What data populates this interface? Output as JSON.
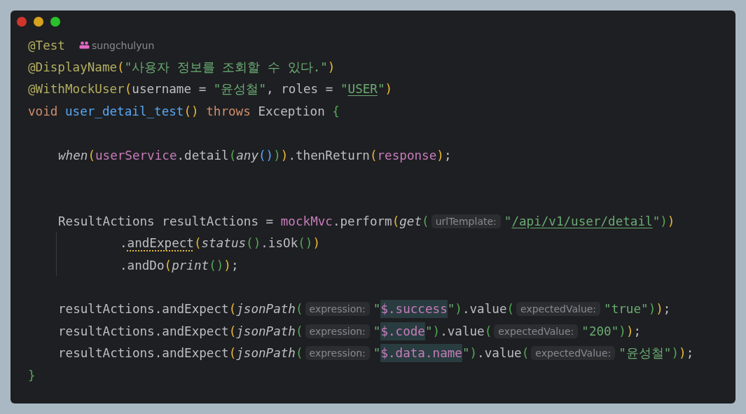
{
  "window": {
    "buttons": [
      {
        "kind": "close"
      },
      {
        "kind": "minimize"
      },
      {
        "kind": "zoom"
      }
    ]
  },
  "lines": [
    {
      "kind": "code",
      "segments": [
        {
          "kind": "code",
          "tokens": [
            {
              "text": "@Test",
              "kind": "annotation"
            }
          ]
        },
        {
          "kind": "author",
          "text": "sungchulyun"
        }
      ]
    },
    {
      "kind": "code",
      "segments": [
        {
          "kind": "code",
          "tokens": [
            {
              "text": "@DisplayName",
              "kind": "annotation"
            },
            {
              "text": "(",
              "kind": "paren1"
            },
            {
              "text": "\"사용자 정보를 조회할 수 있다.\"",
              "kind": "string"
            },
            {
              "text": ")",
              "kind": "paren1"
            }
          ]
        }
      ]
    },
    {
      "kind": "code",
      "segments": [
        {
          "kind": "code",
          "tokens": [
            {
              "text": "@WithMockUser",
              "kind": "annotation"
            },
            {
              "text": "(",
              "kind": "paren1"
            },
            {
              "text": "username = ",
              "kind": "plain"
            },
            {
              "text": "\"윤성철\"",
              "kind": "string"
            },
            {
              "text": ", roles = ",
              "kind": "plain"
            },
            {
              "text": "\"",
              "kind": "string"
            },
            {
              "text": "USER",
              "kind": "link"
            },
            {
              "text": "\"",
              "kind": "string"
            },
            {
              "text": ")",
              "kind": "paren1"
            }
          ]
        }
      ]
    },
    {
      "kind": "code",
      "segments": [
        {
          "kind": "code",
          "tokens": [
            {
              "text": "void ",
              "kind": "keyword"
            },
            {
              "text": "user_detail_test",
              "kind": "method"
            },
            {
              "text": "()",
              "kind": "paren1"
            },
            {
              "text": " throws ",
              "kind": "keyword"
            },
            {
              "text": "Exception ",
              "kind": "plain"
            },
            {
              "text": "{",
              "kind": "paren2"
            }
          ]
        }
      ],
      "children": [
        {
          "kind": "blank"
        },
        {
          "kind": "code",
          "segments": [
            {
              "kind": "code",
              "tokens": [
                {
                  "text": "when",
                  "kind": "call"
                },
                {
                  "text": "(",
                  "kind": "paren1"
                },
                {
                  "text": "userService",
                  "kind": "field"
                },
                {
                  "text": ".detail",
                  "kind": "plain"
                },
                {
                  "text": "(",
                  "kind": "paren2"
                },
                {
                  "text": "any",
                  "kind": "call"
                },
                {
                  "text": "()",
                  "kind": "paren3"
                },
                {
                  "text": ")",
                  "kind": "paren2"
                },
                {
                  "text": ")",
                  "kind": "paren1"
                },
                {
                  "text": ".thenReturn",
                  "kind": "plain"
                },
                {
                  "text": "(",
                  "kind": "paren1"
                },
                {
                  "text": "response",
                  "kind": "field"
                },
                {
                  "text": ")",
                  "kind": "paren1"
                },
                {
                  "text": ";",
                  "kind": "plain"
                }
              ]
            }
          ]
        },
        {
          "kind": "blank"
        },
        {
          "kind": "blank"
        },
        {
          "kind": "code",
          "segments": [
            {
              "kind": "code",
              "tokens": [
                {
                  "text": "ResultActions resultActions = ",
                  "kind": "plain"
                },
                {
                  "text": "mockMvc",
                  "kind": "field"
                },
                {
                  "text": ".perform",
                  "kind": "plain"
                },
                {
                  "text": "(",
                  "kind": "paren1"
                },
                {
                  "text": "get",
                  "kind": "call"
                },
                {
                  "text": "(",
                  "kind": "paren2"
                }
              ]
            },
            {
              "kind": "hint",
              "text": "urlTemplate:"
            },
            {
              "kind": "code",
              "tokens": [
                {
                  "text": "\"",
                  "kind": "string"
                },
                {
                  "text": "/api/v1/user/detail",
                  "kind": "link"
                },
                {
                  "text": "\"",
                  "kind": "string"
                },
                {
                  "text": ")",
                  "kind": "paren2"
                },
                {
                  "text": ")",
                  "kind": "paren1"
                }
              ]
            }
          ],
          "children": [
            {
              "kind": "code",
              "segments": [
                {
                  "kind": "code",
                  "tokens": [
                    {
                      "text": ".",
                      "kind": "plain"
                    },
                    {
                      "text": "andExpect",
                      "kind": "warned"
                    },
                    {
                      "text": "(",
                      "kind": "paren1"
                    },
                    {
                      "text": "status",
                      "kind": "call"
                    },
                    {
                      "text": "()",
                      "kind": "paren2"
                    },
                    {
                      "text": ".isOk",
                      "kind": "plain"
                    },
                    {
                      "text": "()",
                      "kind": "paren2"
                    },
                    {
                      "text": ")",
                      "kind": "paren1"
                    }
                  ]
                }
              ]
            },
            {
              "kind": "code",
              "segments": [
                {
                  "kind": "code",
                  "tokens": [
                    {
                      "text": ".andDo",
                      "kind": "plain"
                    },
                    {
                      "text": "(",
                      "kind": "paren1"
                    },
                    {
                      "text": "print",
                      "kind": "call"
                    },
                    {
                      "text": "()",
                      "kind": "paren2"
                    },
                    {
                      "text": ")",
                      "kind": "paren1"
                    },
                    {
                      "text": ";",
                      "kind": "plain"
                    }
                  ]
                }
              ]
            }
          ]
        },
        {
          "kind": "blank"
        },
        {
          "kind": "code",
          "segments": [
            {
              "kind": "code",
              "tokens": [
                {
                  "text": "resultActions.andExpect",
                  "kind": "plain"
                },
                {
                  "text": "(",
                  "kind": "paren1"
                },
                {
                  "text": "jsonPath",
                  "kind": "call"
                },
                {
                  "text": "(",
                  "kind": "paren2"
                }
              ]
            },
            {
              "kind": "hint",
              "text": "expression:"
            },
            {
              "kind": "code",
              "tokens": [
                {
                  "text": "\"",
                  "kind": "string"
                },
                {
                  "text": "$.success",
                  "kind": "match"
                },
                {
                  "text": "\"",
                  "kind": "string"
                },
                {
                  "text": ")",
                  "kind": "paren2"
                },
                {
                  "text": ".value",
                  "kind": "plain"
                },
                {
                  "text": "(",
                  "kind": "paren2"
                }
              ]
            },
            {
              "kind": "hint",
              "text": "expectedValue:"
            },
            {
              "kind": "code",
              "tokens": [
                {
                  "text": "\"true\"",
                  "kind": "string"
                },
                {
                  "text": ")",
                  "kind": "paren2"
                },
                {
                  "text": ")",
                  "kind": "paren1"
                },
                {
                  "text": ";",
                  "kind": "plain"
                }
              ]
            }
          ]
        },
        {
          "kind": "code",
          "segments": [
            {
              "kind": "code",
              "tokens": [
                {
                  "text": "resultActions.andExpect",
                  "kind": "plain"
                },
                {
                  "text": "(",
                  "kind": "paren1"
                },
                {
                  "text": "jsonPath",
                  "kind": "call"
                },
                {
                  "text": "(",
                  "kind": "paren2"
                }
              ]
            },
            {
              "kind": "hint",
              "text": "expression:"
            },
            {
              "kind": "code",
              "tokens": [
                {
                  "text": "\"",
                  "kind": "string"
                },
                {
                  "text": "$.code",
                  "kind": "match"
                },
                {
                  "text": "\"",
                  "kind": "string"
                },
                {
                  "text": ")",
                  "kind": "paren2"
                },
                {
                  "text": ".value",
                  "kind": "plain"
                },
                {
                  "text": "(",
                  "kind": "paren2"
                }
              ]
            },
            {
              "kind": "hint",
              "text": "expectedValue:"
            },
            {
              "kind": "code",
              "tokens": [
                {
                  "text": "\"200\"",
                  "kind": "string"
                },
                {
                  "text": ")",
                  "kind": "paren2"
                },
                {
                  "text": ")",
                  "kind": "paren1"
                },
                {
                  "text": ";",
                  "kind": "plain"
                }
              ]
            }
          ]
        },
        {
          "kind": "code",
          "segments": [
            {
              "kind": "code",
              "tokens": [
                {
                  "text": "resultActions.andExpect",
                  "kind": "plain"
                },
                {
                  "text": "(",
                  "kind": "paren1"
                },
                {
                  "text": "jsonPath",
                  "kind": "call"
                },
                {
                  "text": "(",
                  "kind": "paren2"
                }
              ]
            },
            {
              "kind": "hint",
              "text": "expression:"
            },
            {
              "kind": "code",
              "tokens": [
                {
                  "text": "\"",
                  "kind": "string"
                },
                {
                  "text": "$.data.name",
                  "kind": "match"
                },
                {
                  "text": "\"",
                  "kind": "string"
                },
                {
                  "text": ")",
                  "kind": "paren2"
                },
                {
                  "text": ".value",
                  "kind": "plain"
                },
                {
                  "text": "(",
                  "kind": "paren2"
                }
              ]
            },
            {
              "kind": "hint",
              "text": "expectedValue:"
            },
            {
              "kind": "code",
              "tokens": [
                {
                  "text": "\"윤성철\"",
                  "kind": "string"
                },
                {
                  "text": ")",
                  "kind": "paren2"
                },
                {
                  "text": ")",
                  "kind": "paren1"
                },
                {
                  "text": ";",
                  "kind": "plain"
                }
              ]
            }
          ]
        }
      ]
    },
    {
      "kind": "code",
      "segments": [
        {
          "kind": "code",
          "tokens": [
            {
              "text": "}",
              "kind": "paren2"
            }
          ]
        }
      ]
    }
  ]
}
